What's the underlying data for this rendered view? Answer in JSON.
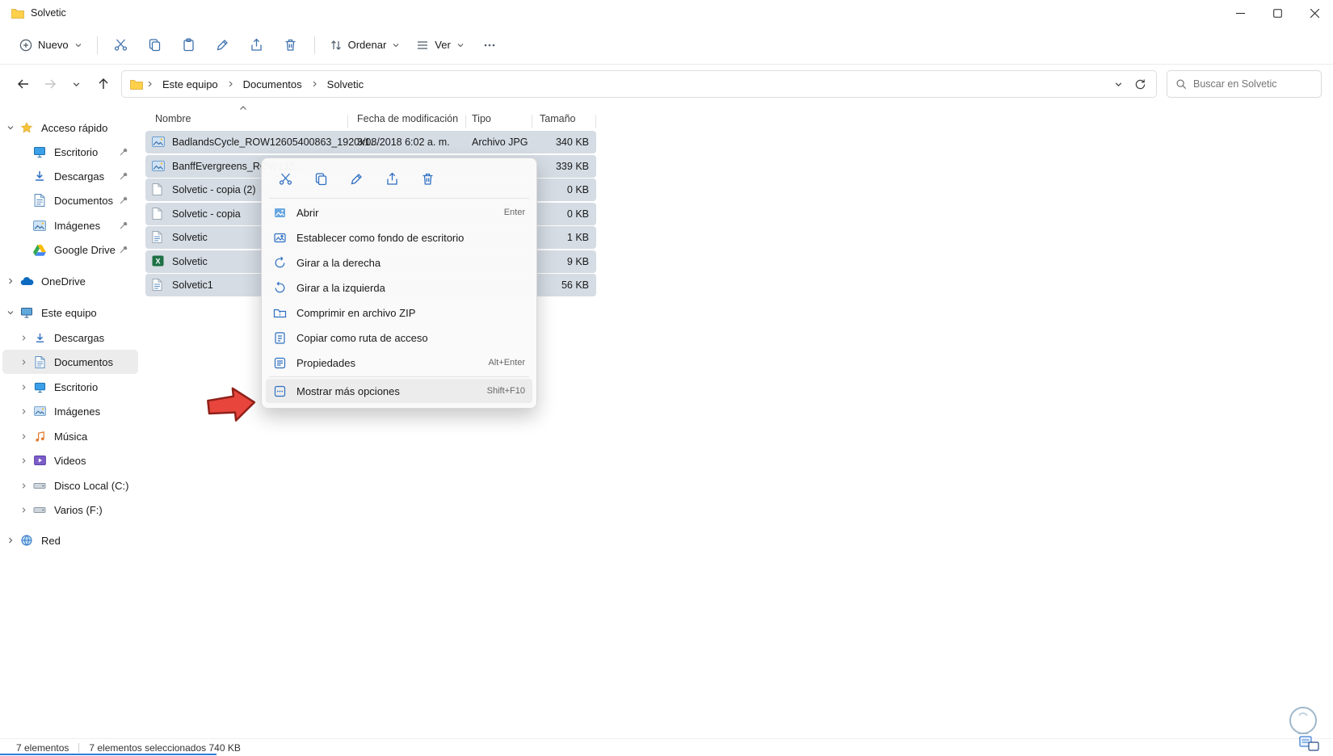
{
  "window": {
    "title": "Solvetic"
  },
  "toolbar": {
    "nuevo_label": "Nuevo",
    "ordenar_label": "Ordenar",
    "ver_label": "Ver"
  },
  "navbar": {
    "breadcrumb": [
      {
        "label": "Este equipo"
      },
      {
        "label": "Documentos"
      },
      {
        "label": "Solvetic"
      }
    ],
    "search_placeholder": "Buscar en Solvetic"
  },
  "sidebar": {
    "quick_access": {
      "label": "Acceso rápido",
      "items": [
        {
          "label": "Escritorio"
        },
        {
          "label": "Descargas"
        },
        {
          "label": "Documentos"
        },
        {
          "label": "Imágenes"
        },
        {
          "label": "Google Drive"
        }
      ]
    },
    "onedrive": {
      "label": "OneDrive"
    },
    "this_pc": {
      "label": "Este equipo",
      "items": [
        {
          "label": "Descargas"
        },
        {
          "label": "Documentos"
        },
        {
          "label": "Escritorio"
        },
        {
          "label": "Imágenes"
        },
        {
          "label": "Música"
        },
        {
          "label": "Videos"
        },
        {
          "label": "Disco Local (C:)"
        },
        {
          "label": "Varios (F:)"
        }
      ]
    },
    "network": {
      "label": "Red"
    }
  },
  "file_list": {
    "columns": {
      "name": "Nombre",
      "date": "Fecha de modificación",
      "type": "Tipo",
      "size": "Tamaño"
    },
    "rows": [
      {
        "name": "BadlandsCycle_ROW12605400863_1920x1...",
        "date": "3/08/2018 6:02 a. m.",
        "type": "Archivo JPG",
        "size": "340 KB"
      },
      {
        "name": "BanffEvergreens_ROW132...",
        "date": "",
        "type": "",
        "size": "339 KB"
      },
      {
        "name": "Solvetic - copia (2)",
        "date": "",
        "type": "",
        "size": "0 KB"
      },
      {
        "name": "Solvetic - copia",
        "date": "",
        "type": "",
        "size": "0 KB"
      },
      {
        "name": "Solvetic",
        "date": "",
        "type": "",
        "size": "1 KB"
      },
      {
        "name": "Solvetic",
        "date": "",
        "type": "",
        "size": "9 KB"
      },
      {
        "name": "Solvetic1",
        "date": "",
        "type": "",
        "size": "56 KB"
      }
    ]
  },
  "context_menu": {
    "items": [
      {
        "label": "Abrir",
        "shortcut": "Enter"
      },
      {
        "label": "Establecer como fondo de escritorio",
        "shortcut": ""
      },
      {
        "label": "Girar a la derecha",
        "shortcut": ""
      },
      {
        "label": "Girar a la izquierda",
        "shortcut": ""
      },
      {
        "label": "Comprimir en archivo ZIP",
        "shortcut": ""
      },
      {
        "label": "Copiar como ruta de acceso",
        "shortcut": ""
      },
      {
        "label": "Propiedades",
        "shortcut": "Alt+Enter"
      },
      {
        "label": "Mostrar más opciones",
        "shortcut": "Shift+F10"
      }
    ]
  },
  "status_bar": {
    "total": "7 elementos",
    "selection": "7 elementos seleccionados 740 KB"
  },
  "colors": {
    "selection": "#d5dce4",
    "accent_blue": "#2e6fc1",
    "arrow_red": "#e8453c"
  }
}
